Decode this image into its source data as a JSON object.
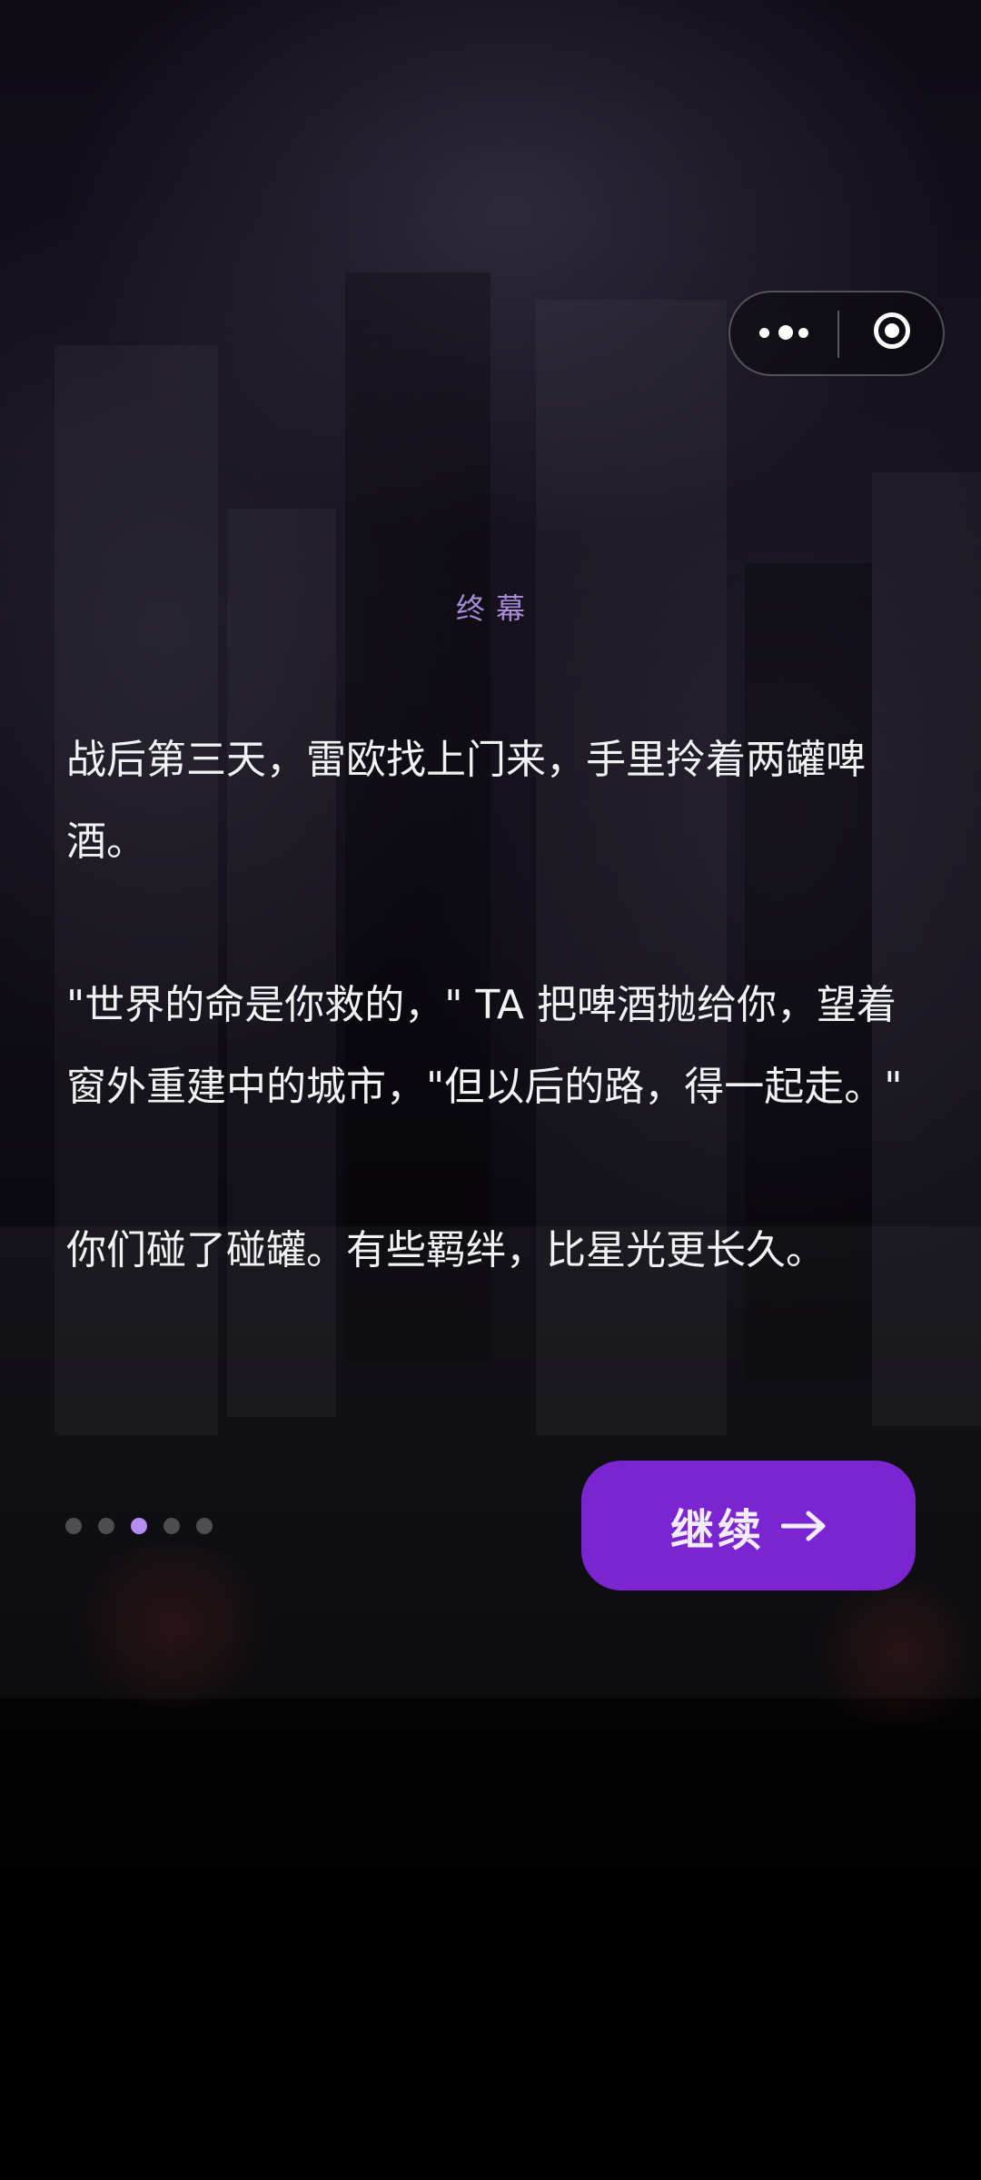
{
  "capsule": {
    "more_icon": "more-dots-icon",
    "close_icon": "target-circle-icon"
  },
  "chapter": {
    "label": "终幕"
  },
  "story": {
    "paragraphs": [
      "战后第三天，雷欧找上门来，手里拎着两罐啤酒。",
      "\"世界的命是你救的，\" TA 把啤酒抛给你，望着窗外重建中的城市，\"但以后的路，得一起走。\"",
      "你们碰了碰罐。有些羁绊，比星光更长久。"
    ]
  },
  "pager": {
    "total": 5,
    "current": 3,
    "active_color": "#b68cf2",
    "inactive_color": "#4d4d52"
  },
  "continue_button": {
    "label": "继续",
    "icon": "arrow-right-icon",
    "color": "#7b25d2"
  }
}
